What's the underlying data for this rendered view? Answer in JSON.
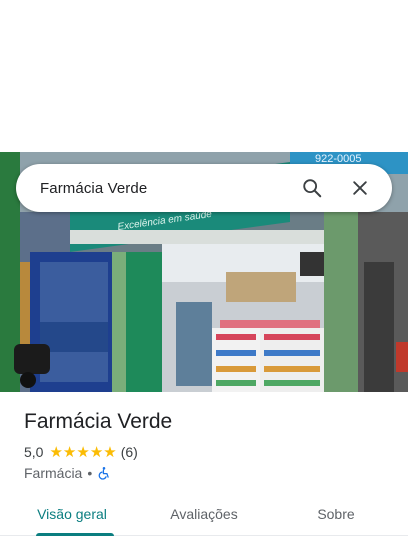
{
  "search": {
    "query": "Farmácia Verde"
  },
  "place": {
    "name": "Farmácia Verde",
    "rating": "5,0",
    "stars": 5,
    "reviews_count": "(6)",
    "category": "Farmácia",
    "separator": "•",
    "wheelchair_accessible": true
  },
  "tabs": [
    {
      "label": "Visão geral",
      "active": true
    },
    {
      "label": "Avaliações",
      "active": false
    },
    {
      "label": "Sobre",
      "active": false
    }
  ],
  "storefront_sign": {
    "text": "Excelência em saúde",
    "phone_fragment": "922-0005"
  },
  "colors": {
    "accent": "#0b7e80",
    "star": "#fbbc04",
    "storefront_green": "#1e8a5a"
  }
}
